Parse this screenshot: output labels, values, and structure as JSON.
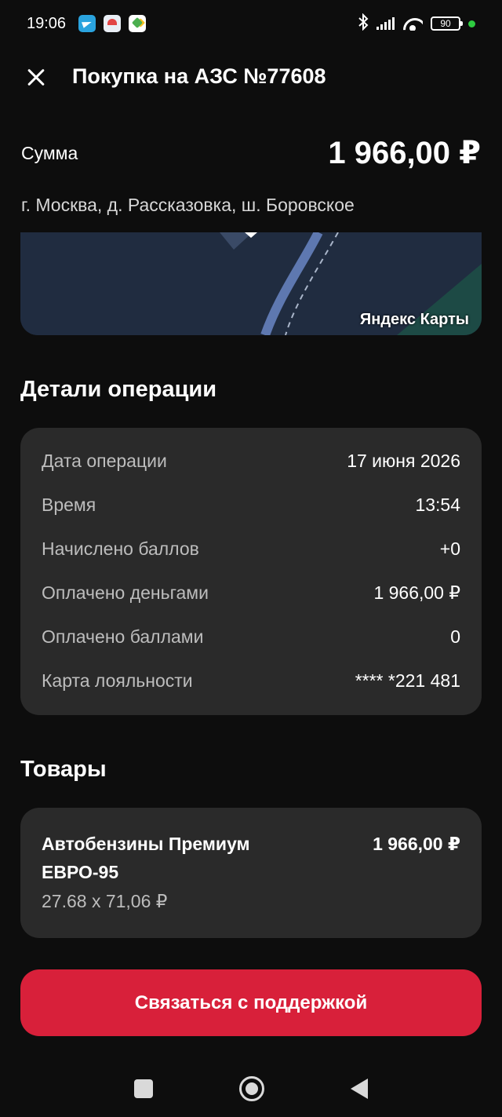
{
  "status_bar": {
    "time": "19:06",
    "battery": "90",
    "notification_icons": [
      "telegram-icon",
      "weather-icon",
      "maps-icon"
    ],
    "system_icons": [
      "bluetooth-icon",
      "signal-icon",
      "wifi-icon",
      "battery-icon"
    ]
  },
  "header": {
    "title": "Покупка на АЗС №77608"
  },
  "amount": {
    "label": "Сумма",
    "value": "1 966,00 ₽"
  },
  "address": "г. Москва, д. Рассказовка, ш. Боровское",
  "map": {
    "attribution": "Яндекс Карты"
  },
  "details": {
    "title": "Детали операции",
    "rows": [
      {
        "label": "Дата операции",
        "value": "17 июня 2026"
      },
      {
        "label": "Время",
        "value": "13:54"
      },
      {
        "label": "Начислено баллов",
        "value": "+0"
      },
      {
        "label": "Оплачено деньгами",
        "value": "1 966,00 ₽"
      },
      {
        "label": "Оплачено баллами",
        "value": "0"
      },
      {
        "label": "Карта лояльности",
        "value": "**** *221 481"
      }
    ]
  },
  "products": {
    "title": "Товары",
    "items": [
      {
        "name": "Автобензины Премиум ЕВРО-95",
        "price": "1 966,00 ₽",
        "quantity": "27.68 x 71,06 ₽"
      }
    ]
  },
  "support_button": {
    "label": "Связаться с поддержкой"
  },
  "colors": {
    "background": "#0d0d0d",
    "card": "#2a2a2a",
    "accent": "#d8203a"
  }
}
